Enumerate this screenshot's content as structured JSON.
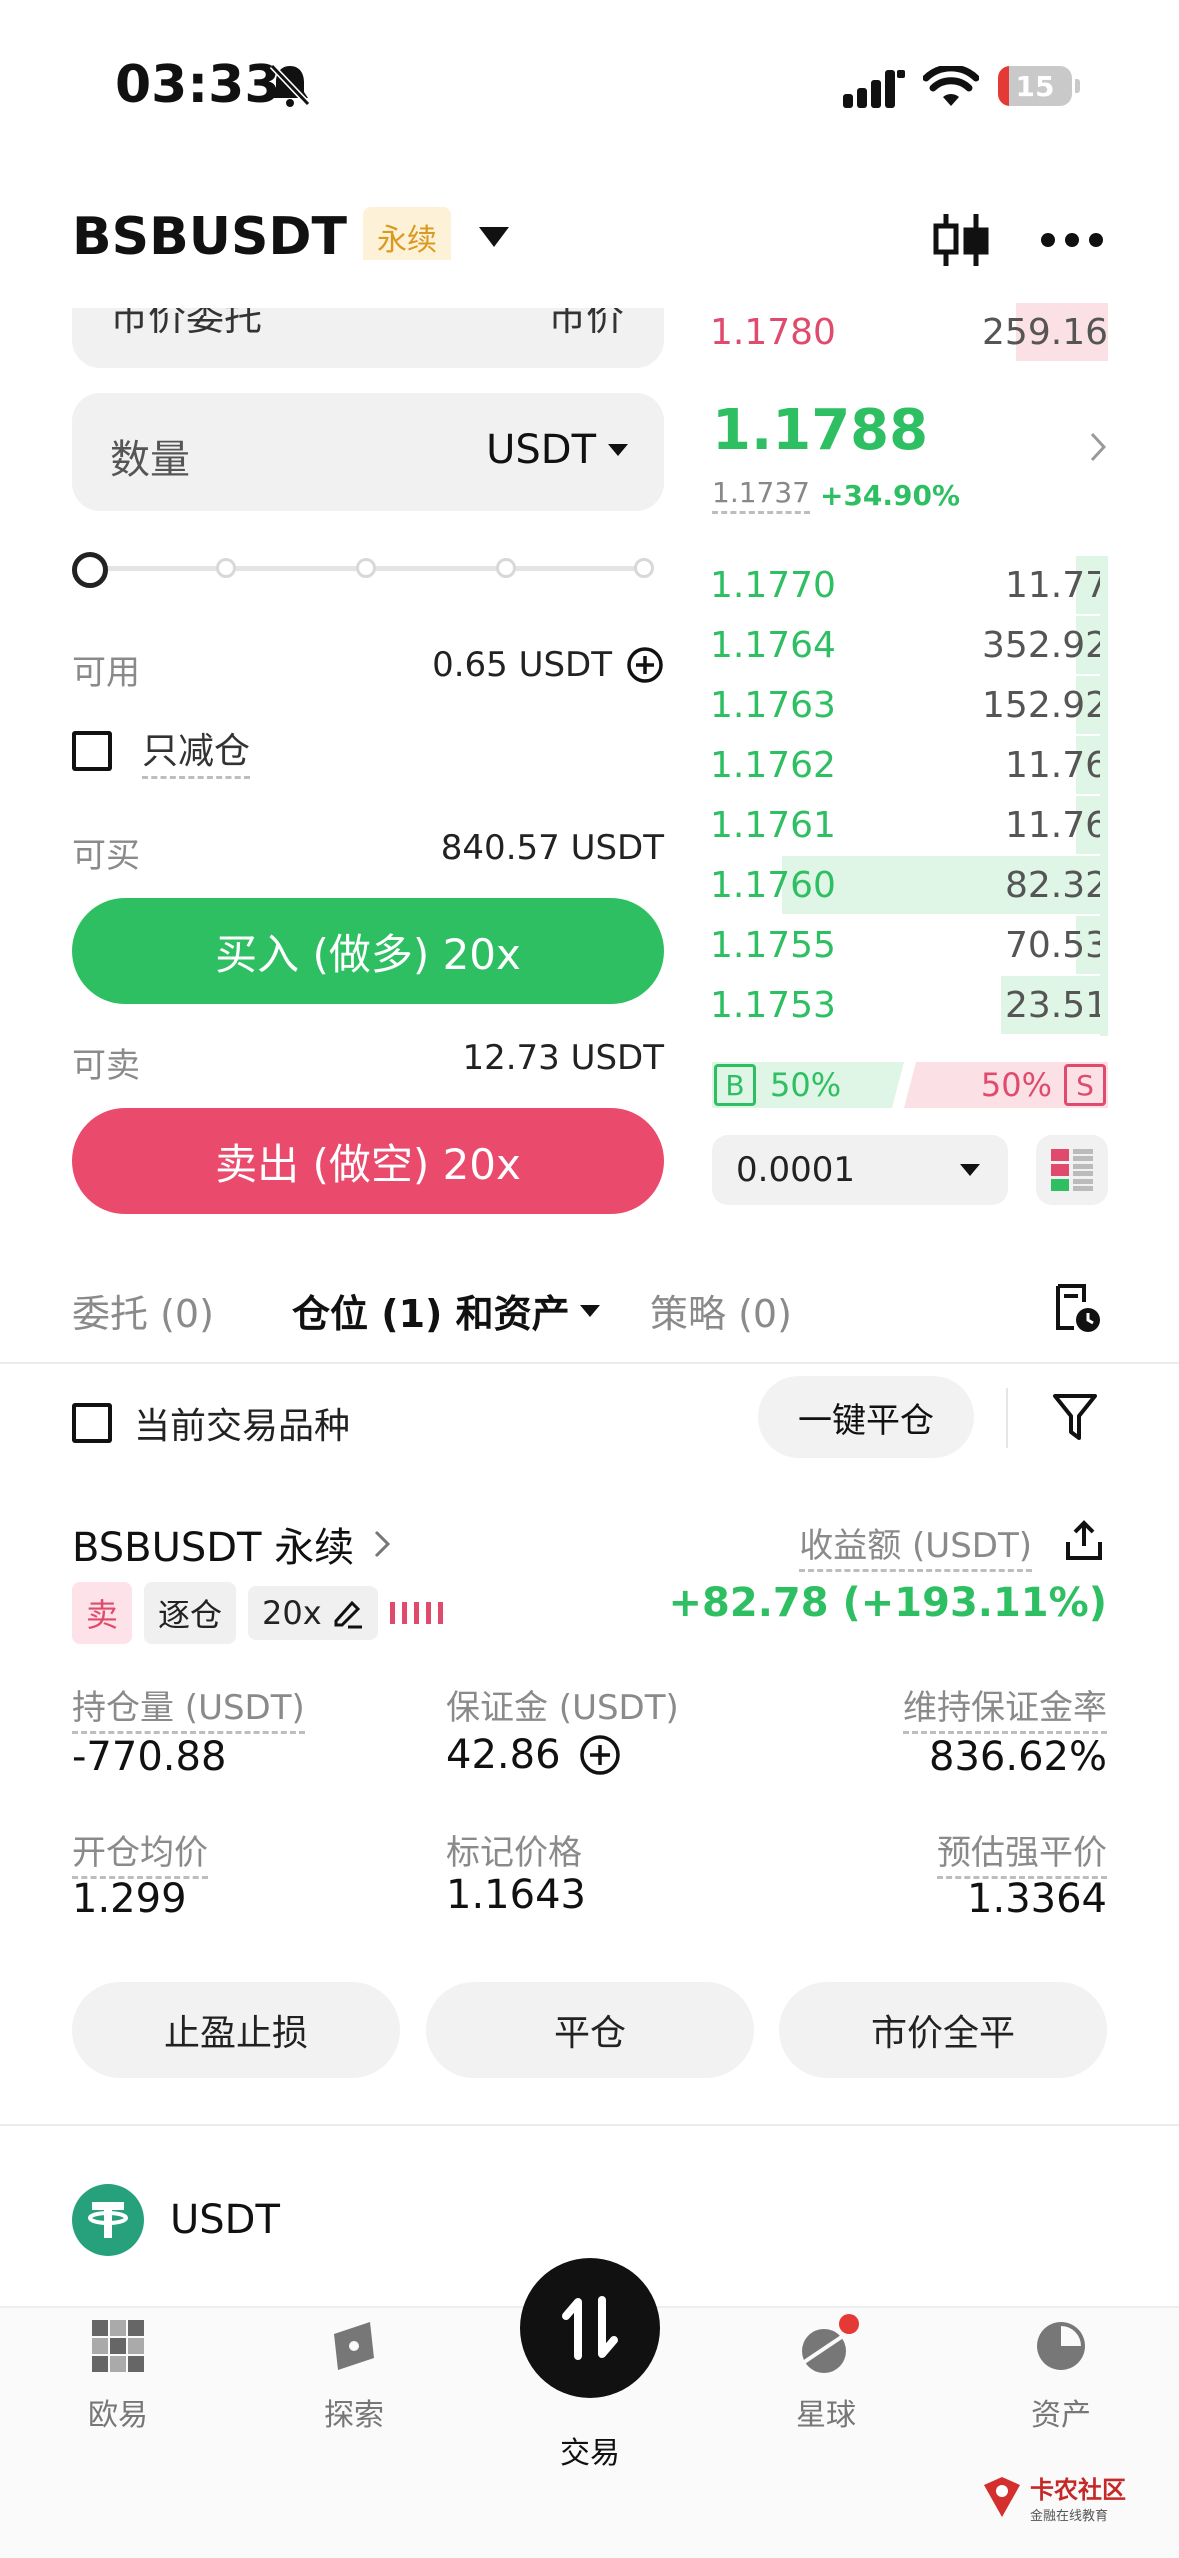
{
  "status": {
    "time": "03:33",
    "battery": "15"
  },
  "header": {
    "pair": "BSBUSDT",
    "badge": "永续"
  },
  "form": {
    "order_type": "市价委托",
    "order_type_right": "市价",
    "qty_label": "数量",
    "qty_unit": "USDT",
    "avail_label": "可用",
    "avail_value": "0.65 USDT",
    "reduce_only": "只减仓",
    "can_buy_label": "可买",
    "can_buy_value": "840.57 USDT",
    "buy_btn": "买入 (做多) 20x",
    "can_sell_label": "可卖",
    "can_sell_value": "12.73 USDT",
    "sell_btn": "卖出 (做空) 20x"
  },
  "orderbook": {
    "ask_top": {
      "price": "1.1780",
      "qty": "259.16"
    },
    "last_price": "1.1788",
    "mark_price": "1.1737",
    "change": "+34.90%",
    "bids": [
      {
        "price": "1.1770",
        "qty": "11.77",
        "depth": 0.08
      },
      {
        "price": "1.1764",
        "qty": "352.92",
        "depth": 0.08
      },
      {
        "price": "1.1763",
        "qty": "152.92",
        "depth": 0.08
      },
      {
        "price": "1.1762",
        "qty": "11.76",
        "depth": 0.08
      },
      {
        "price": "1.1761",
        "qty": "11.76",
        "depth": 0.08
      },
      {
        "price": "1.1760",
        "qty": "82.32",
        "depth": 0.82
      },
      {
        "price": "1.1755",
        "qty": "70.53",
        "depth": 0.08
      },
      {
        "price": "1.1753",
        "qty": "23.51",
        "depth": 0.27
      }
    ],
    "buy_label": "B",
    "buy_pct": "50%",
    "sell_pct": "50%",
    "sell_label": "S",
    "precision": "0.0001"
  },
  "tabs": {
    "t1": "委托 (0)",
    "t2": "仓位 (1) 和资产",
    "t3": "策略 (0)"
  },
  "filter": {
    "current_pair": "当前交易品种",
    "close_all": "一键平仓"
  },
  "position": {
    "title": "BSBUSDT 永续",
    "pnl_label": "收益额 (USDT)",
    "pnl_value": "+82.78 (+193.11%)",
    "side": "卖",
    "margin_mode": "逐仓",
    "leverage": "20x",
    "size_label": "持仓量 (USDT)",
    "size_value": "-770.88",
    "margin_label": "保证金 (USDT)",
    "margin_value": "42.86",
    "mmr_label": "维持保证金率",
    "mmr_value": "836.62%",
    "entry_label": "开仓均价",
    "entry_value": "1.299",
    "mark_label": "标记价格",
    "mark_value": "1.1643",
    "liq_label": "预估强平价",
    "liq_value": "1.3364",
    "btn_tpsl": "止盈止损",
    "btn_close": "平仓",
    "btn_market_close": "市价全平"
  },
  "asset": {
    "name": "USDT"
  },
  "tabbar": {
    "okx": "欧易",
    "explore": "探索",
    "trade": "交易",
    "planet": "星球",
    "assets": "资产"
  },
  "watermark": {
    "line1": "卡农社区",
    "line2": "金融在线教育"
  },
  "colors": {
    "green": "#2fbf63",
    "red": "#e04b6d",
    "badge_bg": "#fdf1d8",
    "badge_text": "#d99a1e"
  }
}
